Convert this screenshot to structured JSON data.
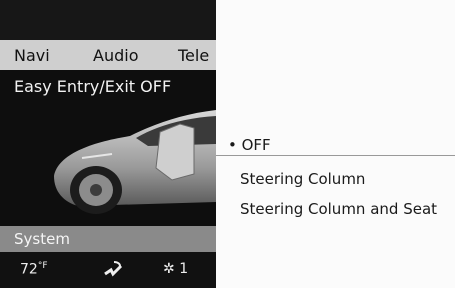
{
  "menu": {
    "items": [
      "Navi",
      "Audio",
      "Tele"
    ]
  },
  "screen": {
    "title": "Easy Entry/Exit OFF",
    "status": "System"
  },
  "climate": {
    "temperature": "72",
    "unit": "°F",
    "fan_icon": "airflow-icon",
    "seat_label": "1",
    "seat_icon": "seat-heat-icon"
  },
  "options": {
    "selected_label": "• OFF",
    "items": [
      "Steering Column",
      "Steering Column and Seat"
    ]
  },
  "colors": {
    "menu_bar": "#cfcfcf",
    "status_bar": "#8a8a8a",
    "screen_bg": "#0e0e0e"
  }
}
